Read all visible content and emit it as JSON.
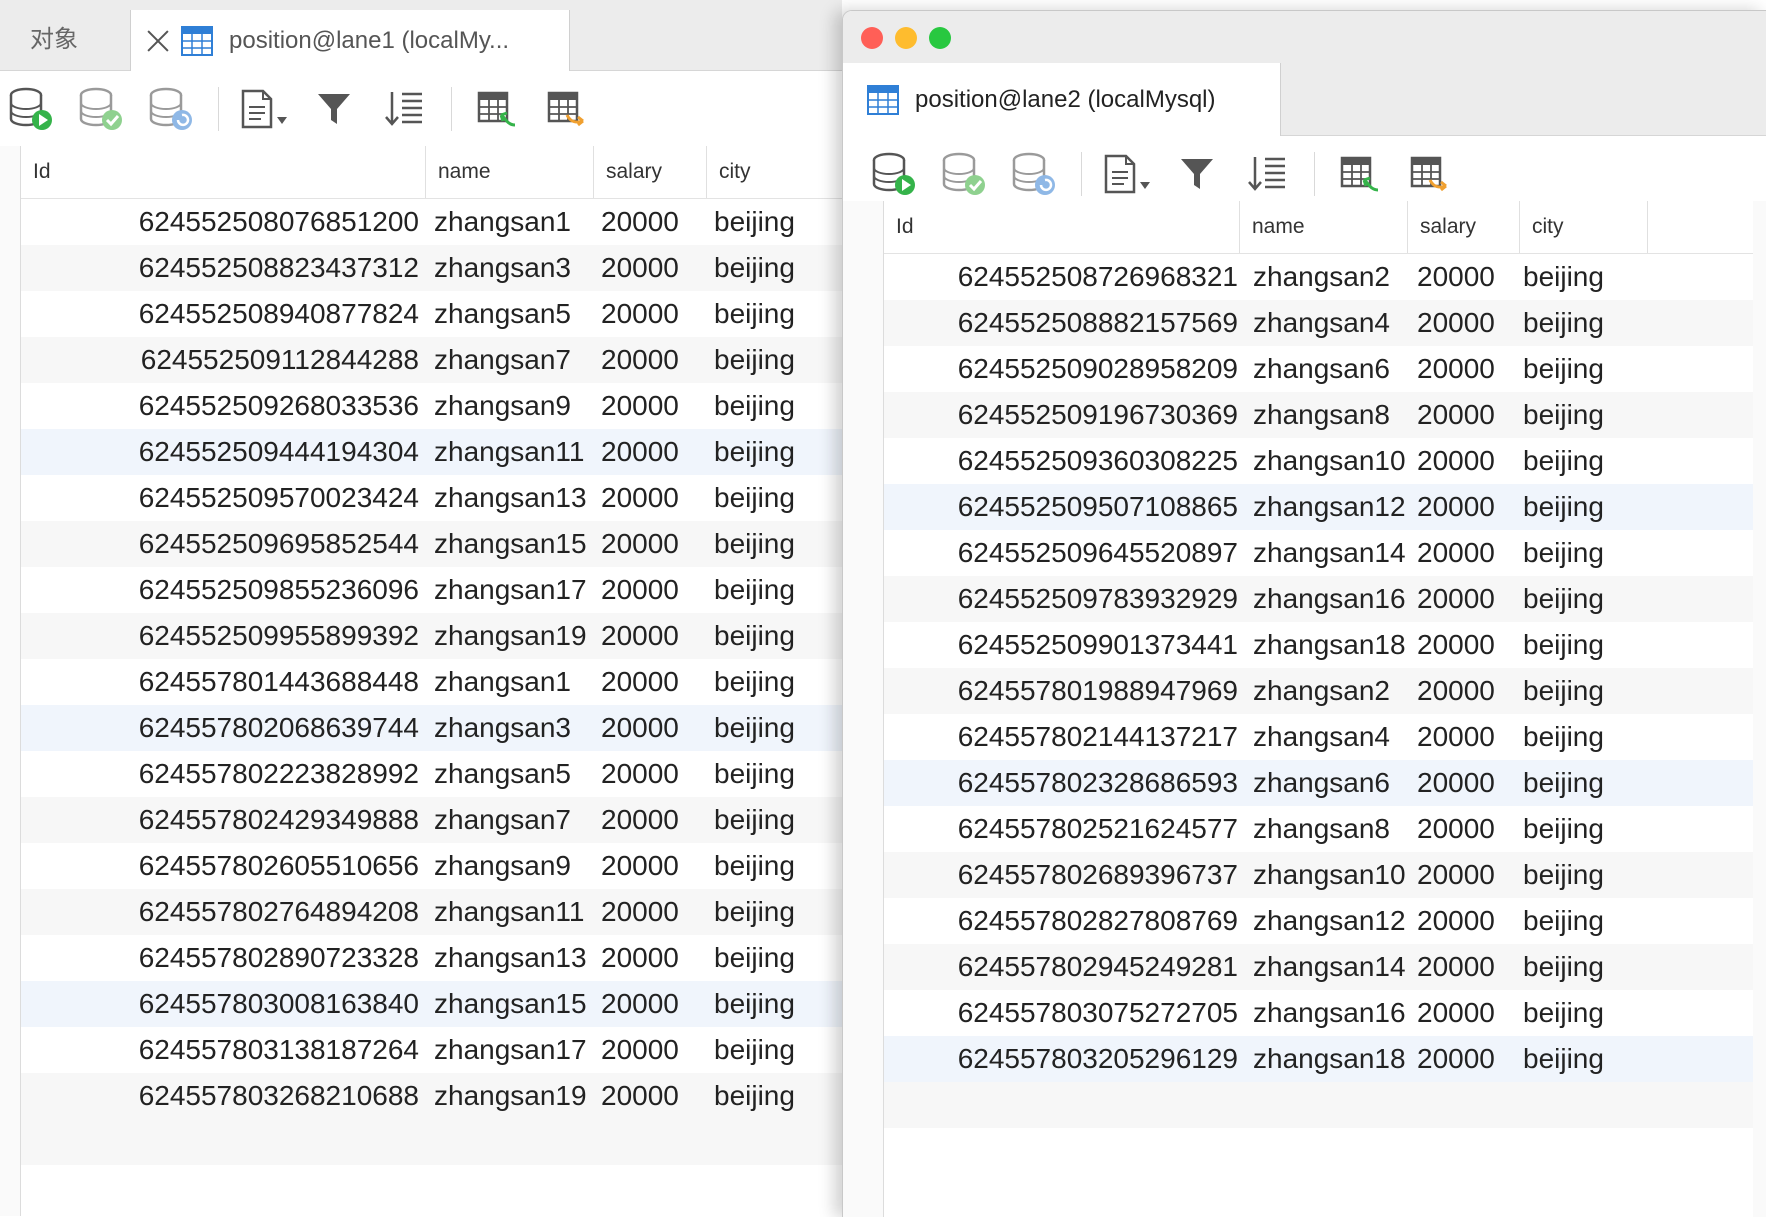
{
  "left": {
    "tabs": {
      "objects_label": "对象",
      "active_label": "position@lane1 (localMy..."
    },
    "columns": [
      "Id",
      "name",
      "salary",
      "city"
    ],
    "rows": [
      [
        "624552508076851200",
        "zhangsan1",
        "20000",
        "beijing"
      ],
      [
        "624552508823437312",
        "zhangsan3",
        "20000",
        "beijing"
      ],
      [
        "624552508940877824",
        "zhangsan5",
        "20000",
        "beijing"
      ],
      [
        "624552509112844288",
        "zhangsan7",
        "20000",
        "beijing"
      ],
      [
        "624552509268033536",
        "zhangsan9",
        "20000",
        "beijing"
      ],
      [
        "624552509444194304",
        "zhangsan11",
        "20000",
        "beijing"
      ],
      [
        "624552509570023424",
        "zhangsan13",
        "20000",
        "beijing"
      ],
      [
        "624552509695852544",
        "zhangsan15",
        "20000",
        "beijing"
      ],
      [
        "624552509855236096",
        "zhangsan17",
        "20000",
        "beijing"
      ],
      [
        "624552509955899392",
        "zhangsan19",
        "20000",
        "beijing"
      ],
      [
        "624557801443688448",
        "zhangsan1",
        "20000",
        "beijing"
      ],
      [
        "624557802068639744",
        "zhangsan3",
        "20000",
        "beijing"
      ],
      [
        "624557802223828992",
        "zhangsan5",
        "20000",
        "beijing"
      ],
      [
        "624557802429349888",
        "zhangsan7",
        "20000",
        "beijing"
      ],
      [
        "624557802605510656",
        "zhangsan9",
        "20000",
        "beijing"
      ],
      [
        "624557802764894208",
        "zhangsan11",
        "20000",
        "beijing"
      ],
      [
        "624557802890723328",
        "zhangsan13",
        "20000",
        "beijing"
      ],
      [
        "624557803008163840",
        "zhangsan15",
        "20000",
        "beijing"
      ],
      [
        "624557803138187264",
        "zhangsan17",
        "20000",
        "beijing"
      ],
      [
        "624557803268210688",
        "zhangsan19",
        "20000",
        "beijing"
      ]
    ]
  },
  "right": {
    "tabs": {
      "active_label": "position@lane2 (localMysql)"
    },
    "columns": [
      "Id",
      "name",
      "salary",
      "city"
    ],
    "rows": [
      [
        "624552508726968321",
        "zhangsan2",
        "20000",
        "beijing"
      ],
      [
        "624552508882157569",
        "zhangsan4",
        "20000",
        "beijing"
      ],
      [
        "624552509028958209",
        "zhangsan6",
        "20000",
        "beijing"
      ],
      [
        "624552509196730369",
        "zhangsan8",
        "20000",
        "beijing"
      ],
      [
        "624552509360308225",
        "zhangsan10",
        "20000",
        "beijing"
      ],
      [
        "624552509507108865",
        "zhangsan12",
        "20000",
        "beijing"
      ],
      [
        "624552509645520897",
        "zhangsan14",
        "20000",
        "beijing"
      ],
      [
        "624552509783932929",
        "zhangsan16",
        "20000",
        "beijing"
      ],
      [
        "624552509901373441",
        "zhangsan18",
        "20000",
        "beijing"
      ],
      [
        "624557801988947969",
        "zhangsan2",
        "20000",
        "beijing"
      ],
      [
        "624557802144137217",
        "zhangsan4",
        "20000",
        "beijing"
      ],
      [
        "624557802328686593",
        "zhangsan6",
        "20000",
        "beijing"
      ],
      [
        "624557802521624577",
        "zhangsan8",
        "20000",
        "beijing"
      ],
      [
        "624557802689396737",
        "zhangsan10",
        "20000",
        "beijing"
      ],
      [
        "624557802827808769",
        "zhangsan12",
        "20000",
        "beijing"
      ],
      [
        "624557802945249281",
        "zhangsan14",
        "20000",
        "beijing"
      ],
      [
        "624557803075272705",
        "zhangsan16",
        "20000",
        "beijing"
      ],
      [
        "624557803205296129",
        "zhangsan18",
        "20000",
        "beijing"
      ]
    ]
  },
  "toolbar_icons": [
    "start-transaction-icon",
    "commit-icon",
    "rollback-icon",
    "text-view-icon",
    "filter-icon",
    "sort-icon",
    "import-icon",
    "export-icon"
  ],
  "colors": {
    "accent": "#2f7fd6",
    "close": "#ff5f57",
    "minimize": "#febc2e",
    "zoom": "#28c840",
    "green": "#35b34a",
    "orange": "#f0a030",
    "gray": "#c9c9c9"
  }
}
